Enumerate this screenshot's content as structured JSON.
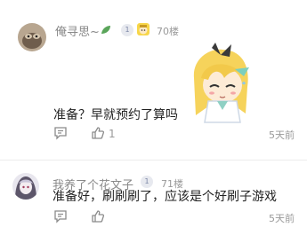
{
  "comments": [
    {
      "username": "俺寻思~",
      "level": "1",
      "floor": "70楼",
      "text": "准备？早就预约了算吗",
      "likes": "1",
      "time": "5天前"
    },
    {
      "username": "我养了个花文子",
      "level": "1",
      "floor": "71楼",
      "text": "准备好，刷刷刷了，应该是个好刷子游戏",
      "likes": "",
      "time": "5天前"
    }
  ],
  "icons": {
    "reply": "comment-icon",
    "like": "thumb-up-icon",
    "badge_leaf": "leaf-icon",
    "badge_char": "character-icon"
  },
  "colors": {
    "name": "#888888",
    "meta": "#999999",
    "text": "#222222",
    "level_bg": "#e7e9ef"
  }
}
